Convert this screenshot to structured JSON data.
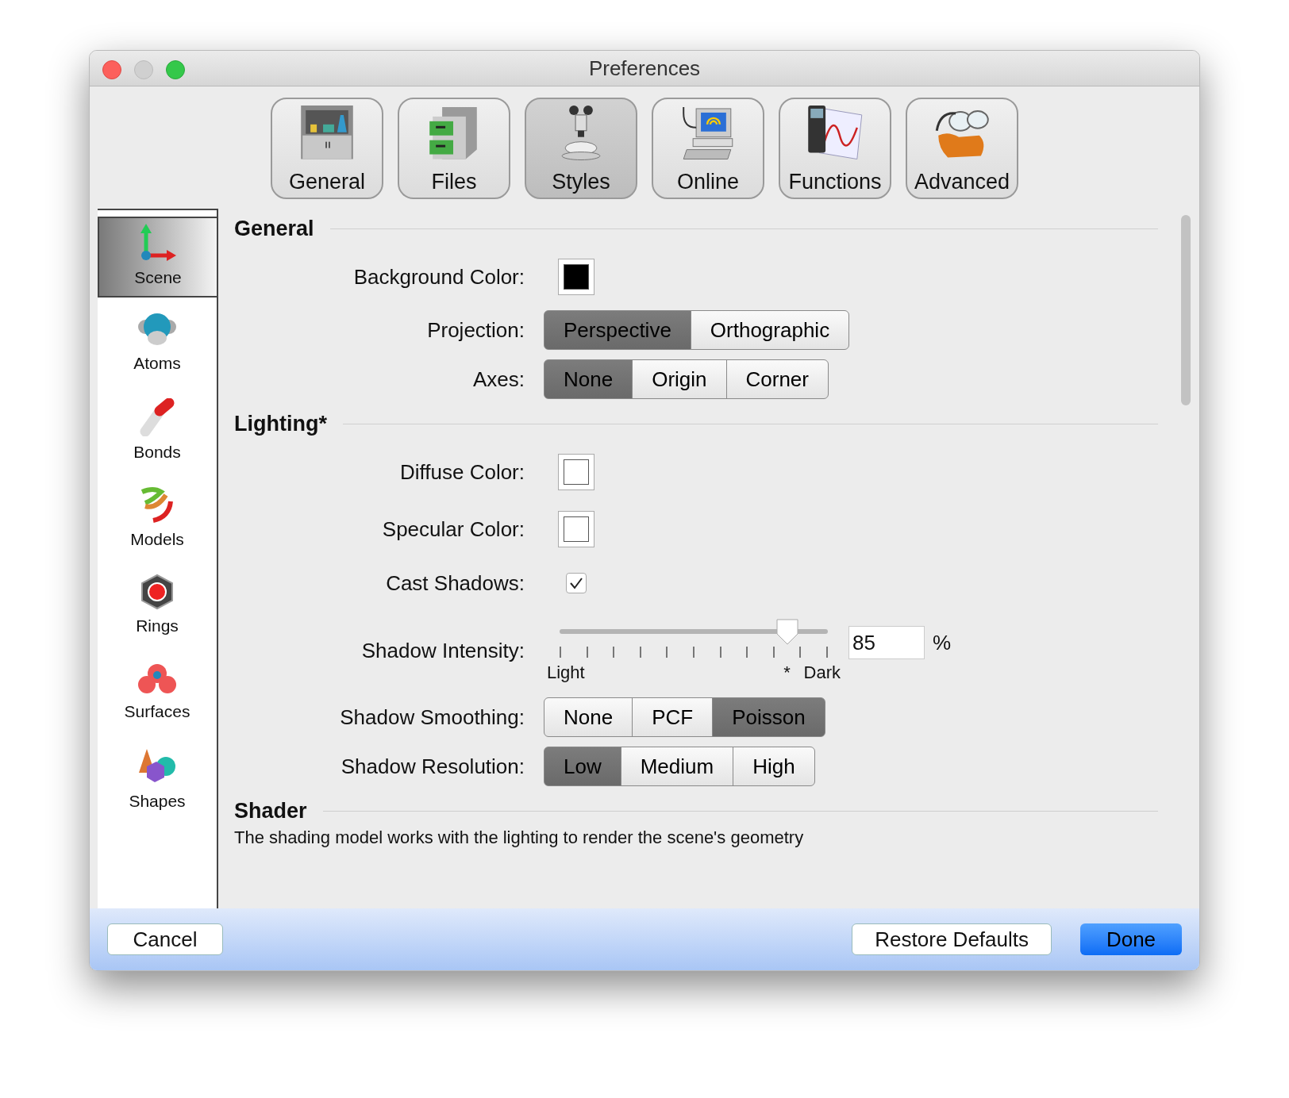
{
  "window": {
    "title": "Preferences"
  },
  "toolbar": [
    {
      "label": "General",
      "selected": false
    },
    {
      "label": "Files",
      "selected": false
    },
    {
      "label": "Styles",
      "selected": true
    },
    {
      "label": "Online",
      "selected": false
    },
    {
      "label": "Functions",
      "selected": false
    },
    {
      "label": "Advanced",
      "selected": false
    }
  ],
  "sidebar": [
    {
      "label": "Scene",
      "selected": true
    },
    {
      "label": "Atoms",
      "selected": false
    },
    {
      "label": "Bonds",
      "selected": false
    },
    {
      "label": "Models",
      "selected": false
    },
    {
      "label": "Rings",
      "selected": false
    },
    {
      "label": "Surfaces",
      "selected": false
    },
    {
      "label": "Shapes",
      "selected": false
    }
  ],
  "sections": [
    {
      "title": "General",
      "rows": [
        {
          "kind": "color",
          "label": "Background Color:",
          "color": "#000000"
        },
        {
          "kind": "segmented",
          "label": "Projection:",
          "options": [
            {
              "label": "Perspective",
              "selected": true
            },
            {
              "label": "Orthographic",
              "selected": false
            }
          ]
        },
        {
          "kind": "segmented",
          "label": "Axes:",
          "options": [
            {
              "label": "None",
              "selected": true
            },
            {
              "label": "Origin",
              "selected": false
            },
            {
              "label": "Corner",
              "selected": false
            }
          ]
        }
      ]
    },
    {
      "title": "Lighting*",
      "rows": [
        {
          "kind": "color",
          "label": "Diffuse Color:",
          "color": "#ffffff"
        },
        {
          "kind": "color",
          "label": "Specular Color:",
          "color": "#ffffff"
        },
        {
          "kind": "checkbox",
          "label": "Cast Shadows:",
          "checked": true
        },
        {
          "kind": "slider",
          "label": "Shadow Intensity:",
          "level": 0.85,
          "min_label": "Light",
          "max_label": "Dark",
          "default_mark": "*",
          "value": "85",
          "unit": "%"
        },
        {
          "kind": "segmented",
          "label": "Shadow Smoothing:",
          "options": [
            {
              "label": "None",
              "selected": false
            },
            {
              "label": "PCF",
              "selected": false
            },
            {
              "label": "Poisson",
              "selected": true
            }
          ]
        },
        {
          "kind": "segmented",
          "label": "Shadow Resolution:",
          "options": [
            {
              "label": "Low",
              "selected": true
            },
            {
              "label": "Medium",
              "selected": false
            },
            {
              "label": "High",
              "selected": false
            }
          ]
        }
      ]
    },
    {
      "title": "Shader",
      "description": "The shading model works with the lighting to render the scene's geometry"
    }
  ],
  "buttons": {
    "cancel": "Cancel",
    "restore": "Restore Defaults",
    "done": "Done"
  }
}
